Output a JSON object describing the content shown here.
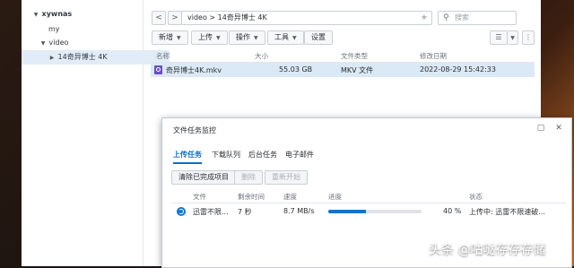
{
  "tree": {
    "root": "xywnas",
    "items": [
      {
        "label": "my"
      },
      {
        "label": "video"
      },
      {
        "label": "14奇异博士 4K"
      }
    ]
  },
  "nav": {
    "path": "video > 14奇异博士 4K",
    "search_placeholder": "搜索"
  },
  "toolbar": {
    "new": "新增",
    "upload": "上传",
    "action": "操作",
    "tools": "工具",
    "settings": "设置"
  },
  "file_table": {
    "headers": [
      "名称",
      "大小",
      "文件类型",
      "修改日期"
    ],
    "rows": [
      {
        "name": "奇异博士4K.mkv",
        "size": "55.03 GB",
        "type": "MKV 文件",
        "modified": "2022-08-29 15:42:33"
      }
    ]
  },
  "dialog": {
    "title": "文件任务监控",
    "tabs": [
      "上传任务",
      "下载队列",
      "后台任务",
      "电子邮件"
    ],
    "buttons": {
      "clear": "清除已完成项目",
      "delete": "删除",
      "restart": "重新开始"
    },
    "headers": [
      "文件",
      "剩余时间",
      "速度",
      "进度",
      "状态"
    ],
    "rows": [
      {
        "file": "迅雷不限...",
        "remaining": "7 秒",
        "speed": "8.7 MB/s",
        "progress": 0.4,
        "progress_text": "40 %",
        "status": "上传中: 迅雷不限速破..."
      }
    ]
  },
  "watermark": "头条 @咕哒存存存储",
  "colors": {
    "accent": "#0b6fc8",
    "selection": "#dbe8f5",
    "progress": "#1473c8"
  }
}
